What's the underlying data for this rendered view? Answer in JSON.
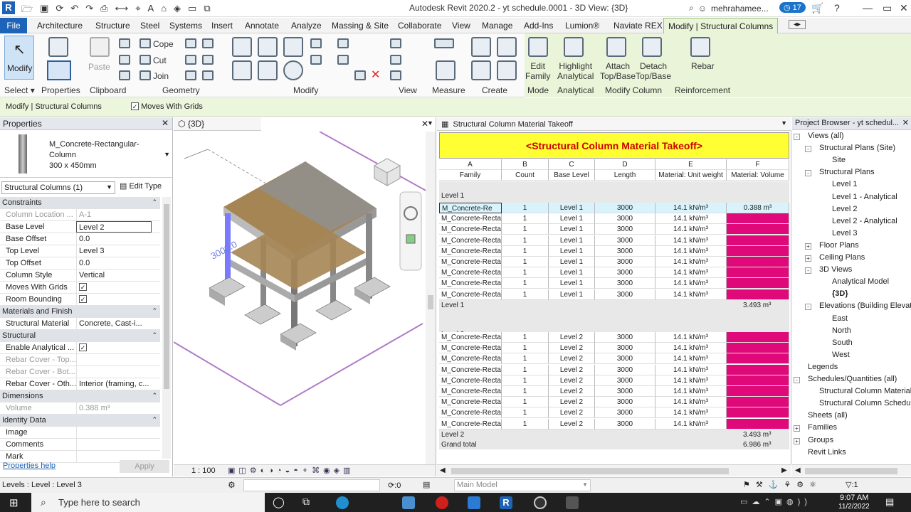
{
  "app": {
    "title": "Autodesk Revit 2020.2 - yt schedule.0001 - 3D View: {3D}",
    "user": "mehrahamee...",
    "notif_count": "17"
  },
  "menu": {
    "file": "File",
    "tabs": [
      "Architecture",
      "Structure",
      "Steel",
      "Systems",
      "Insert",
      "Annotate",
      "Analyze",
      "Massing & Site",
      "Collaborate",
      "View",
      "Manage",
      "Add-Ins",
      "Lumion®",
      "Naviate REX"
    ],
    "active": "Modify | Structural Columns"
  },
  "ribbon": {
    "modify": "Modify",
    "properties": "Properties",
    "paste": "Paste",
    "cope": "Cope",
    "cut": "Cut",
    "join": "Join",
    "edit_family": [
      "Edit",
      "Family"
    ],
    "highlight_analytical": [
      "Highlight",
      "Analytical"
    ],
    "attach": [
      "Attach",
      "Top/Base"
    ],
    "detach": [
      "Detach",
      "Top/Base"
    ],
    "rebar": "Rebar",
    "panels": [
      "Select",
      "Properties",
      "Clipboard",
      "Geometry",
      "Modify",
      "View",
      "Measure",
      "Create",
      "Mode",
      "Analytical",
      "Modify Column",
      "Reinforcement"
    ]
  },
  "optionsbar": {
    "context": "Modify | Structural Columns",
    "moves_with_grids": "Moves With Grids"
  },
  "properties": {
    "title": "Properties",
    "type_name": [
      "M_Concrete-Rectangular-",
      "Column",
      "300 x 450mm"
    ],
    "selector": "Structural Columns (1)",
    "edit_type": "Edit Type",
    "help": "Properties help",
    "apply": "Apply",
    "rows": [
      {
        "k": "Constraints",
        "cat": true
      },
      {
        "k": "Column Location ...",
        "v": "A-1",
        "grey": true
      },
      {
        "k": "Base Level",
        "v": "Level 2"
      },
      {
        "k": "Base Offset",
        "v": "0.0"
      },
      {
        "k": "Top Level",
        "v": "Level 3"
      },
      {
        "k": "Top Offset",
        "v": "0.0"
      },
      {
        "k": "Column Style",
        "v": "Vertical"
      },
      {
        "k": "Moves With Grids",
        "v": "✓",
        "chk": true
      },
      {
        "k": "Room Bounding",
        "v": "✓",
        "chk": true
      },
      {
        "k": "Materials and Finishes",
        "cat": true
      },
      {
        "k": "Structural Material",
        "v": "Concrete, Cast-i..."
      },
      {
        "k": "Structural",
        "cat": true
      },
      {
        "k": "Enable Analytical ...",
        "v": "✓",
        "chk": true
      },
      {
        "k": "Rebar Cover - Top...",
        "v": "",
        "grey": true
      },
      {
        "k": "Rebar Cover - Bot...",
        "v": "",
        "grey": true
      },
      {
        "k": "Rebar Cover - Oth...",
        "v": "Interior (framing, c..."
      },
      {
        "k": "Dimensions",
        "cat": true
      },
      {
        "k": "Volume",
        "v": "0.388 m³",
        "grey": true
      },
      {
        "k": "Identity Data",
        "cat": true
      },
      {
        "k": "Image",
        "v": ""
      },
      {
        "k": "Comments",
        "v": ""
      },
      {
        "k": "Mark",
        "v": ""
      }
    ]
  },
  "view3d": {
    "tab": "{3D}",
    "scale": "1 : 100"
  },
  "schedule": {
    "tab": "Structural Column Material Takeoff",
    "title": "<Structural Column Material Takeoff>",
    "letters": [
      "A",
      "B",
      "C",
      "D",
      "E",
      "F"
    ],
    "headers": [
      "Family",
      "Count",
      "Base Level",
      "Length",
      "Material: Unit weight",
      "Material: Volume"
    ],
    "group1": "Level 1",
    "rows1": [
      [
        "M_Concrete-Re",
        "1",
        "Level 1",
        "3000",
        "14.1 kN/m³",
        "0.388 m³"
      ],
      [
        "M_Concrete-Recta",
        "1",
        "Level 1",
        "3000",
        "14.1 kN/m³",
        "0.388 m³"
      ],
      [
        "M_Concrete-Recta",
        "1",
        "Level 1",
        "3000",
        "14.1 kN/m³",
        "0.388 m³"
      ],
      [
        "M_Concrete-Recta",
        "1",
        "Level 1",
        "3000",
        "14.1 kN/m³",
        "0.388 m³"
      ],
      [
        "M_Concrete-Recta",
        "1",
        "Level 1",
        "3000",
        "14.1 kN/m³",
        "0.388 m³"
      ],
      [
        "M_Concrete-Recta",
        "1",
        "Level 1",
        "3000",
        "14.1 kN/m³",
        "0.388 m³"
      ],
      [
        "M_Concrete-Recta",
        "1",
        "Level 1",
        "3000",
        "14.1 kN/m³",
        "0.388 m³"
      ],
      [
        "M_Concrete-Recta",
        "1",
        "Level 1",
        "3000",
        "14.1 kN/m³",
        "0.388 m³"
      ],
      [
        "M_Concrete-Recta",
        "1",
        "Level 1",
        "3000",
        "14.1 kN/m³",
        "0.388 m³"
      ]
    ],
    "sum1": [
      "Level 1",
      "3.493 m³"
    ],
    "group2": "Level 2",
    "rows2": [
      [
        "M_Concrete-Recta",
        "1",
        "Level 2",
        "3000",
        "14.1 kN/m³",
        "0.388 m³"
      ],
      [
        "M_Concrete-Recta",
        "1",
        "Level 2",
        "3000",
        "14.1 kN/m³",
        "0.388 m³"
      ],
      [
        "M_Concrete-Recta",
        "1",
        "Level 2",
        "3000",
        "14.1 kN/m³",
        "0.388 m³"
      ],
      [
        "M_Concrete-Recta",
        "1",
        "Level 2",
        "3000",
        "14.1 kN/m³",
        "0.388 m³"
      ],
      [
        "M_Concrete-Recta",
        "1",
        "Level 2",
        "3000",
        "14.1 kN/m³",
        "0.388 m³"
      ],
      [
        "M_Concrete-Recta",
        "1",
        "Level 2",
        "3000",
        "14.1 kN/m³",
        "0.388 m³"
      ],
      [
        "M_Concrete-Recta",
        "1",
        "Level 2",
        "3000",
        "14.1 kN/m³",
        "0.388 m³"
      ],
      [
        "M_Concrete-Recta",
        "1",
        "Level 2",
        "3000",
        "14.1 kN/m³",
        "0.388 m³"
      ],
      [
        "M_Concrete-Recta",
        "1",
        "Level 2",
        "3000",
        "14.1 kN/m³",
        "0.388 m³"
      ]
    ],
    "sum2": [
      "Level 2",
      "3.493 m³"
    ],
    "grand": [
      "Grand total",
      "6.986 m³"
    ]
  },
  "browser": {
    "title": "Project Browser - yt schedul...",
    "items": [
      {
        "t": "Views (all)",
        "d": 1,
        "e": "-"
      },
      {
        "t": "Structural Plans (Site)",
        "d": 2,
        "e": "-"
      },
      {
        "t": "Site",
        "d": 3
      },
      {
        "t": "Structural Plans",
        "d": 2,
        "e": "-"
      },
      {
        "t": "Level 1",
        "d": 3
      },
      {
        "t": "Level 1 - Analytical",
        "d": 3
      },
      {
        "t": "Level 2",
        "d": 3
      },
      {
        "t": "Level 2 - Analytical",
        "d": 3
      },
      {
        "t": "Level 3",
        "d": 3
      },
      {
        "t": "Floor Plans",
        "d": 2,
        "e": "+"
      },
      {
        "t": "Ceiling Plans",
        "d": 2,
        "e": "+"
      },
      {
        "t": "3D Views",
        "d": 2,
        "e": "-"
      },
      {
        "t": "Analytical Model",
        "d": 3
      },
      {
        "t": "{3D}",
        "d": 3,
        "b": true
      },
      {
        "t": "Elevations (Building Elevation)",
        "d": 2,
        "e": "-"
      },
      {
        "t": "East",
        "d": 3
      },
      {
        "t": "North",
        "d": 3
      },
      {
        "t": "South",
        "d": 3
      },
      {
        "t": "West",
        "d": 3
      },
      {
        "t": "Legends",
        "d": 1
      },
      {
        "t": "Schedules/Quantities (all)",
        "d": 1,
        "e": "-"
      },
      {
        "t": "Structural Column Material Takeoff",
        "d": 2
      },
      {
        "t": "Structural Column Schedule",
        "d": 2
      },
      {
        "t": "Sheets (all)",
        "d": 1
      },
      {
        "t": "Families",
        "d": 1,
        "e": "+"
      },
      {
        "t": "Groups",
        "d": 1,
        "e": "+"
      },
      {
        "t": "Revit Links",
        "d": 1
      }
    ]
  },
  "status": {
    "text": "Levels : Level : Level 3",
    "zero": ":0",
    "model": "Main Model",
    "filter": ":1"
  },
  "taskbar": {
    "search": "Type here to search",
    "time": "9:07 AM",
    "date": "11/2/2022"
  }
}
